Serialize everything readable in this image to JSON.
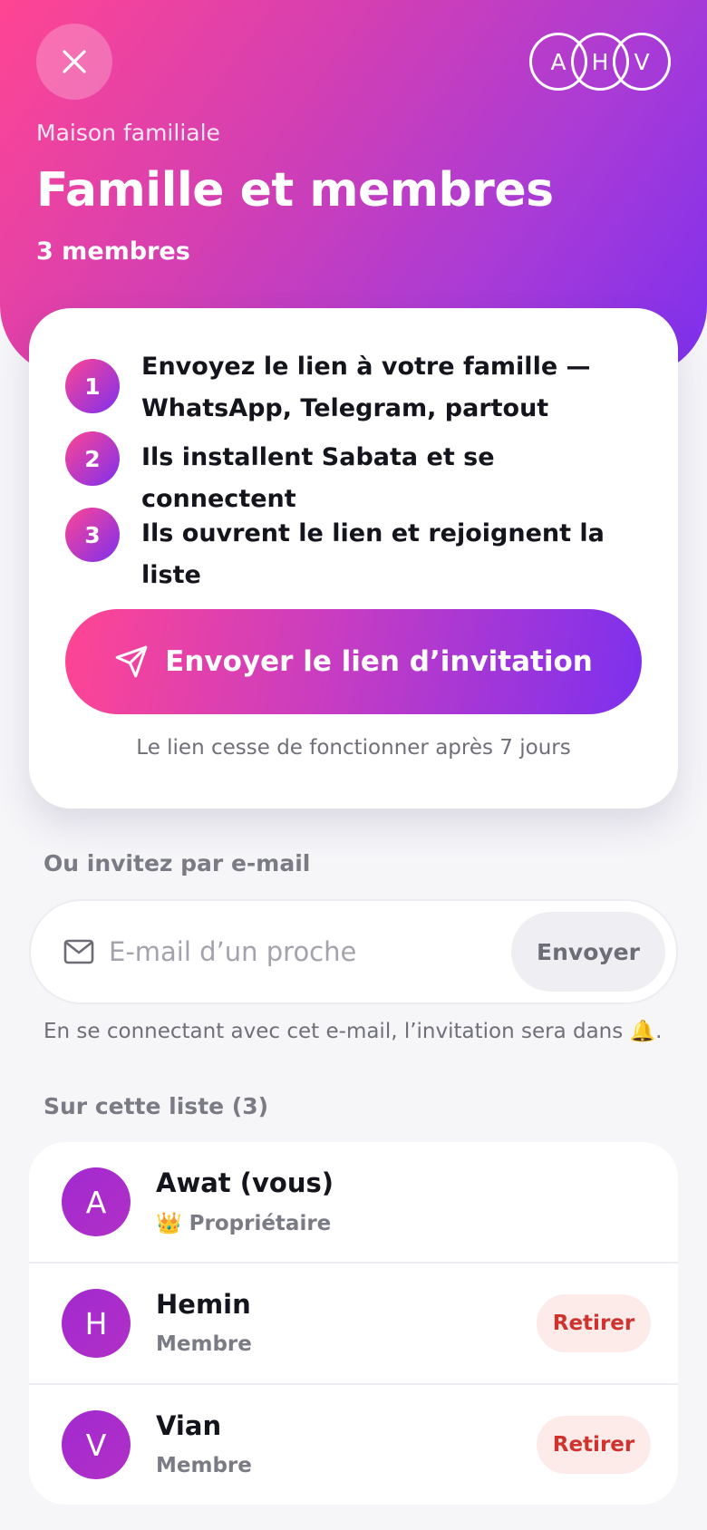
{
  "header": {
    "close_icon": "close-icon",
    "avatars": [
      "A",
      "H",
      "V"
    ],
    "household": "Maison familiale",
    "title": "Famille et membres",
    "member_count": "3 membres"
  },
  "invite": {
    "steps": [
      {
        "num": "1",
        "text": "Envoyez le lien à votre famille — WhatsApp, Telegram, partout"
      },
      {
        "num": "2",
        "text": "Ils installent Sabata et se connectent"
      },
      {
        "num": "3",
        "text": "Ils ouvrent le lien et rejoignent la liste"
      }
    ],
    "button_icon": "send-icon",
    "button_label": "Envoyer le lien d’invitation",
    "expiry": "Le lien cesse de fonctionner après 7 jours"
  },
  "email": {
    "section_label": "Ou invitez par e-mail",
    "icon": "mail-icon",
    "value": "",
    "placeholder": "E-mail d’un proche",
    "send_label": "Envoyer",
    "hint": "En se connectant avec cet e-mail, l’invitation sera dans 🔔."
  },
  "members": {
    "section_label": "Sur cette liste (3)",
    "items": [
      {
        "initial": "A",
        "name": "Awat (vous)",
        "role": "👑 Propriétaire",
        "remove_label": ""
      },
      {
        "initial": "H",
        "name": "Hemin",
        "role": "Membre",
        "remove_label": "Retirer"
      },
      {
        "initial": "V",
        "name": "Vian",
        "role": "Membre",
        "remove_label": "Retirer"
      }
    ]
  },
  "colors": {
    "gradient_start": "#ff4593",
    "gradient_end": "#7d30ee",
    "member_avatar": "#a32ad0",
    "danger": "#d0322d",
    "danger_bg": "#fdebea",
    "background": "#f6f6f9"
  }
}
